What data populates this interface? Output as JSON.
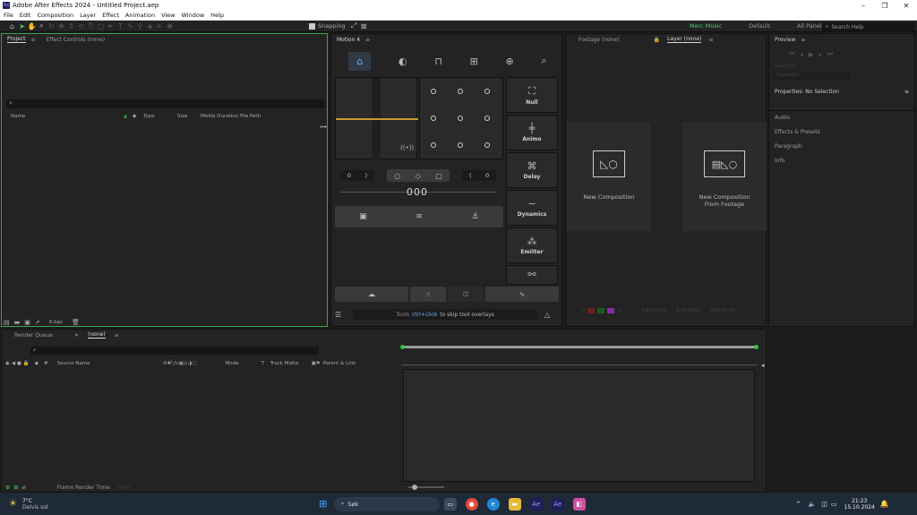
{
  "window": {
    "title": "Adobe After Effects 2024 - Untitled Project.aep",
    "app_icon": "Ae",
    "controls": [
      "–",
      "❐",
      "✕"
    ]
  },
  "menu": [
    "File",
    "Edit",
    "Composition",
    "Layer",
    "Effect",
    "Animation",
    "View",
    "Window",
    "Help"
  ],
  "toolbar": {
    "snapping_label": "Snapping"
  },
  "workspaces": {
    "active": "Merc Music",
    "default": "Default",
    "all_panels": "All Panels",
    "search_placeholder": "Search Help"
  },
  "project": {
    "tab_project": "Project",
    "tab_effect_controls": "Effect Controls (none)",
    "columns": [
      "Name",
      "Type",
      "Size",
      "Media Duration",
      "File Path"
    ],
    "bpc": "8 bpc"
  },
  "motion": {
    "title": "Motion 4",
    "left_value": "0",
    "right_value": "0",
    "counter": "000",
    "buttons": [
      "Null",
      "Animo",
      "Delay",
      "Dynamics",
      "Emitter"
    ],
    "hint_prefix": "Tools",
    "hint_key": "ctrl+click",
    "hint_suffix": "to skip tool overlays"
  },
  "viewer": {
    "tab_footage": "Footage (none)",
    "tab_layer": "Layer (none)",
    "new_comp": "New Composition",
    "new_comp_footage_line1": "New Composition",
    "new_comp_footage_line2": "From Footage",
    "tc1": "0;00;00;00",
    "tc2": "0;00;00;00",
    "tc3": "0;00;00;00"
  },
  "right": {
    "preview": "Preview",
    "shortcut": "Shortcut",
    "spacebar": "Spacebar",
    "properties": "Properties: No Selection",
    "sections": [
      "Audio",
      "Effects & Presets",
      "Paragraph",
      "Info"
    ]
  },
  "timeline": {
    "tab_render": "Render Queue",
    "tab_comp": "(none)",
    "cols": [
      "Source Name",
      "Mode",
      "T",
      "Track Matte",
      "Parent & Link"
    ],
    "frame_render_label": "Frame Render Time:",
    "frame_render_value": "0ms"
  },
  "taskbar": {
    "temp": "7°C",
    "weather": "Delvis sol",
    "search": "Søk",
    "time": "21:23",
    "date": "15.10.2024"
  },
  "colors": {
    "accent_green": "#3fd16a",
    "panel": "#232323",
    "timebar": "#2fc24a"
  }
}
